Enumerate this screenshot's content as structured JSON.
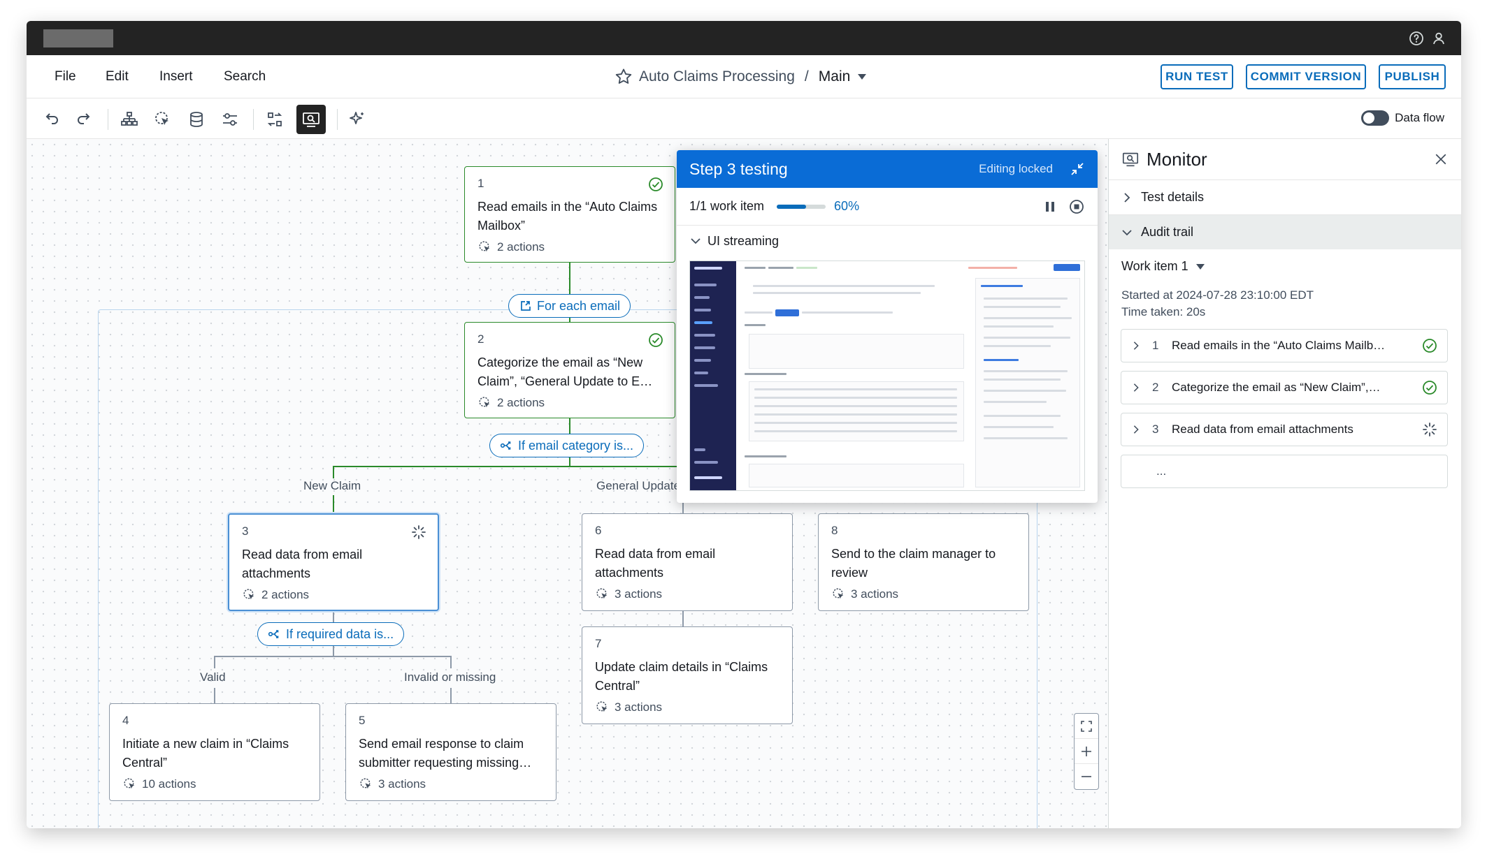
{
  "menu": {
    "file": "File",
    "edit": "Edit",
    "insert": "Insert",
    "search": "Search"
  },
  "document": {
    "name": "Auto Claims Processing",
    "separator": "/",
    "branch": "Main"
  },
  "actions": {
    "run_test": "RUN TEST",
    "commit_version": "COMMIT VERSION",
    "publish": "PUBLISH"
  },
  "toolbar": {
    "data_flow_label": "Data flow",
    "data_flow_on": false
  },
  "flow": {
    "loop_label": "For each email",
    "condition_email": "If email category is...",
    "condition_data": "If required data is...",
    "branches": {
      "new_claim": "New Claim",
      "general_update": "General Update",
      "valid": "Valid",
      "invalid": "Invalid or missing"
    },
    "nodes": [
      {
        "num": "1",
        "title": "Read emails in the “Auto Claims Mailbox”",
        "actions": "2 actions",
        "status": "done"
      },
      {
        "num": "2",
        "title": "Categorize the email as “New Claim”, “General Update to E…",
        "actions": "2 actions",
        "status": "done"
      },
      {
        "num": "3",
        "title": "Read data from email attachments",
        "actions": "2 actions",
        "status": "running"
      },
      {
        "num": "4",
        "title": "Initiate a new claim in “Claims Central”",
        "actions": "10 actions",
        "status": ""
      },
      {
        "num": "5",
        "title": "Send email response to claim submitter requesting missing…",
        "actions": "3 actions",
        "status": ""
      },
      {
        "num": "6",
        "title": "Read data from email attachments",
        "actions": "3 actions",
        "status": ""
      },
      {
        "num": "7",
        "title": "Update claim details in “Claims Central”",
        "actions": "3 actions",
        "status": ""
      },
      {
        "num": "8",
        "title": "Send to the claim manager to review",
        "actions": "3 actions",
        "status": ""
      }
    ]
  },
  "test_panel": {
    "title": "Step 3 testing",
    "locked": "Editing locked",
    "work_items": "1/1 work item",
    "progress": 0.6,
    "progress_text": "60%",
    "streaming_label": "UI streaming"
  },
  "monitor": {
    "title": "Monitor",
    "test_details": "Test details",
    "audit_trail": "Audit trail",
    "work_item": "Work item 1",
    "started": "Started at 2024-07-28 23:10:00 EDT",
    "time_taken": "Time taken: 20s",
    "rows": [
      {
        "num": "1",
        "label": "Read emails in the “Auto Claims Mailb…",
        "status": "done"
      },
      {
        "num": "2",
        "label": "Categorize the email as “New Claim”,…",
        "status": "done"
      },
      {
        "num": "3",
        "label": "Read data from email attachments",
        "status": "running"
      }
    ],
    "more": "..."
  },
  "colors": {
    "accent": "#0a6cba",
    "success": "#2a8a2a",
    "panel_header": "#0a6cd6"
  }
}
